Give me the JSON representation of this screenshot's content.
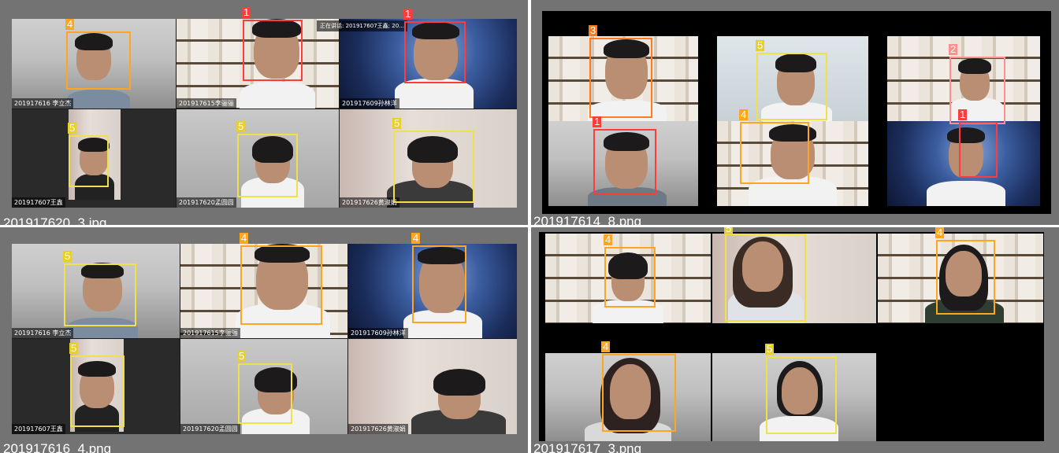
{
  "colors": {
    "class1": "#ff3b3b",
    "class2": "#ff8f8f",
    "class3": "#ff7a1a",
    "class4": "#ffa51f",
    "class5": "#f0e04a"
  },
  "panels": {
    "top_left": {
      "filename": "201917620_3.jpg",
      "speaker_notice": "正在讲话: 201917607王鑫; 20...",
      "tiles": [
        {
          "caption": "201917616 李立杰",
          "box_label": "4"
        },
        {
          "caption": "201917615李骊骊",
          "box_label": "1"
        },
        {
          "caption": "201917609孙林洋",
          "box_label": "1"
        },
        {
          "caption": "201917607王鑫",
          "box_label": "5"
        },
        {
          "caption": "201917620孟圆圆",
          "box_label": "5"
        },
        {
          "caption": "201917626黄淑娟",
          "box_label": "5"
        }
      ]
    },
    "top_right": {
      "filename": "201917614_8.png",
      "labels": [
        "3",
        "5",
        "2",
        "1",
        "4",
        "1"
      ]
    },
    "bottom_left": {
      "filename": "201917616_4.png",
      "tiles": [
        {
          "caption": "201917616 李立杰",
          "box_label": "5"
        },
        {
          "caption": "201917615李骊骊",
          "box_label": "4"
        },
        {
          "caption": "201917609孙林洋",
          "box_label": "4"
        },
        {
          "caption": "201917607王鑫",
          "box_label": "5"
        },
        {
          "caption": "201917620孟圆圆",
          "box_label": "5"
        },
        {
          "caption": "201917626黄淑娟",
          "box_label": ""
        }
      ]
    },
    "bottom_right": {
      "filename": "201917617_3.png",
      "labels": [
        "4",
        "5",
        "4",
        "4",
        "5"
      ]
    }
  }
}
